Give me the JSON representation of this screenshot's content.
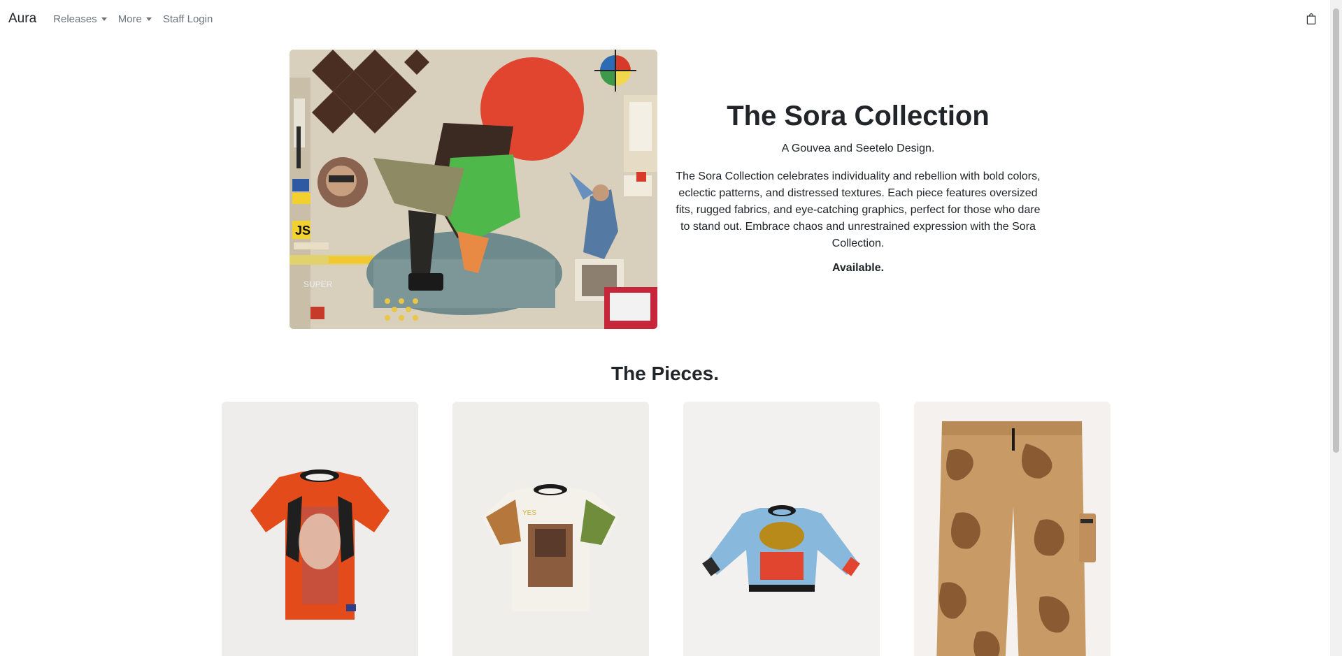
{
  "navbar": {
    "brand": "Aura",
    "releases": "Releases",
    "more": "More",
    "staff_login": "Staff Login"
  },
  "hero": {
    "title": "The Sora Collection",
    "subtitle": "A Gouvea and Seetelo Design.",
    "description": "The Sora Collection celebrates individuality and rebellion with bold colors, eclectic patterns, and distressed textures. Each piece features oversized fits, rugged fabrics, and eye-catching graphics, perfect for those who dare to stand out. Embrace chaos and unrestrained expression with the Sora Collection.",
    "status": "Available."
  },
  "pieces": {
    "title": "The Pieces.",
    "items": [
      {
        "icon": "orange-graphic-tee"
      },
      {
        "icon": "photo-print-tee"
      },
      {
        "icon": "blue-graphic-sweater"
      },
      {
        "icon": "camo-cargo-pants"
      }
    ]
  },
  "colors": {
    "accent_red": "#e2452f",
    "text": "#212529",
    "muted": "#6c757d"
  }
}
